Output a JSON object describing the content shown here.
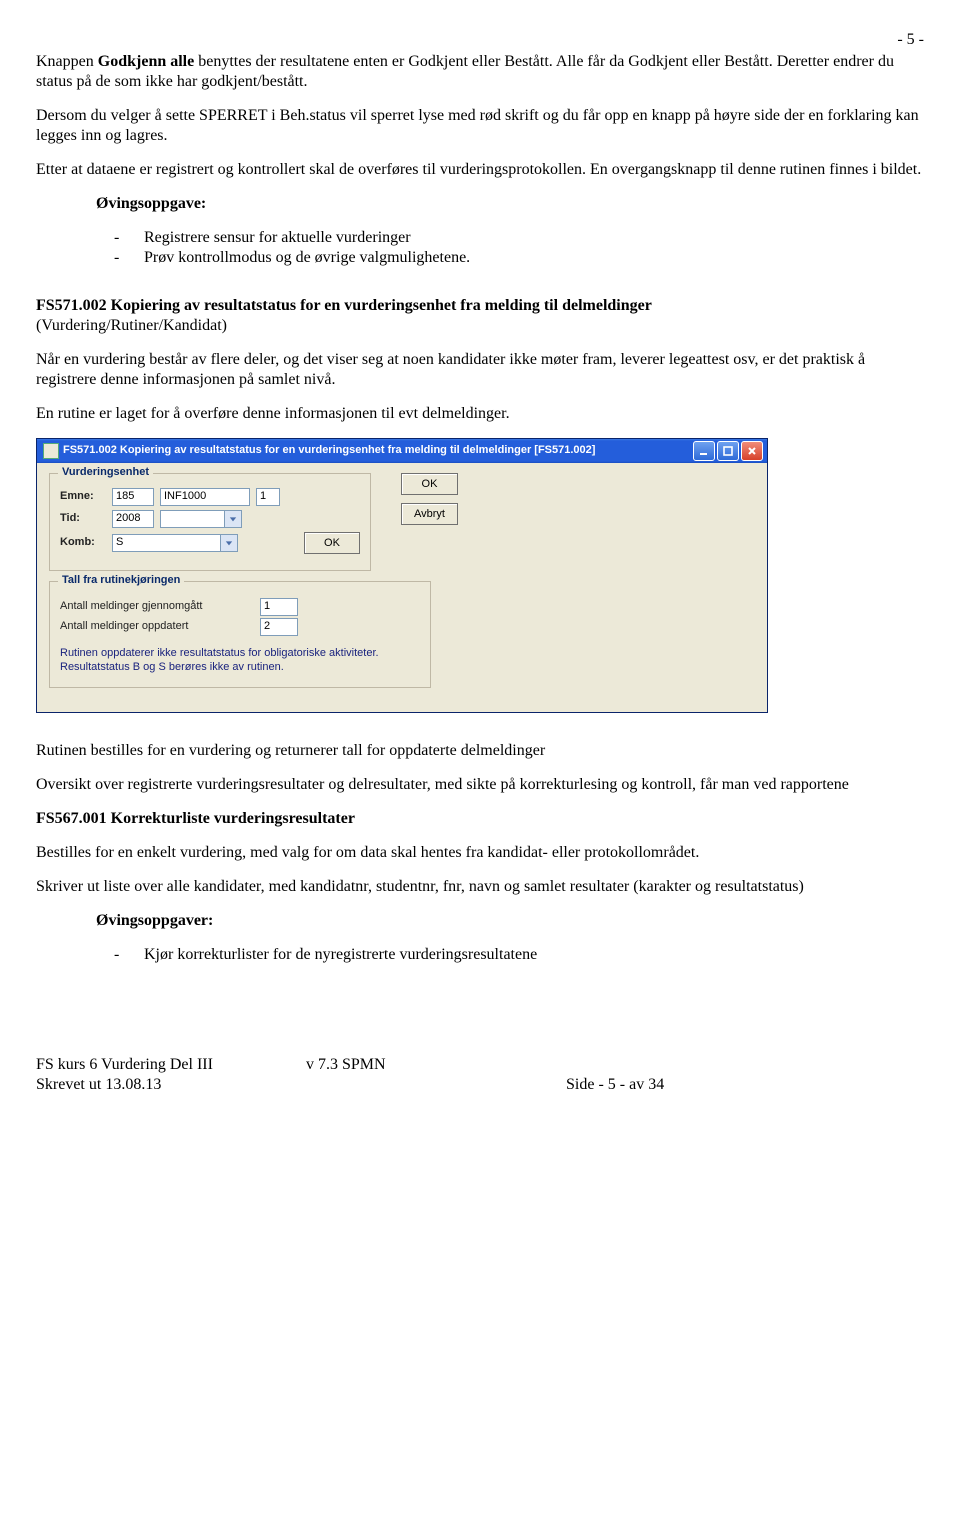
{
  "page_number_top": "- 5 -",
  "para1_a": "Knappen ",
  "para1_b_bold": "Godkjenn alle",
  "para1_c": " benyttes der resultatene enten er Godkjent eller Bestått. Alle får da Godkjent eller Bestått. Deretter endrer du status på de som ikke har godkjent/bestått.",
  "para2": "Dersom du velger å sette SPERRET i Beh.status vil sperret lyse med rød skrift og du får opp en knapp på høyre side der en forklaring kan legges inn og lagres.",
  "para3": "Etter at dataene er registrert og kontrollert skal de overføres til vurderingsprotokollen. En overgangsknapp til denne rutinen finnes i bildet.",
  "ov1_heading": "Øvingsoppgave:",
  "ov1_item1": "Registrere sensur for aktuelle vurderinger",
  "ov1_item2": "Prøv kontrollmodus og de øvrige valgmulighetene.",
  "h2_a": "FS571.002 Kopiering av resultatstatus for en vurderingsenhet fra melding til delmeldinger",
  "h2_sub": "(Vurdering/Rutiner/Kandidat)",
  "para4": "Når en vurdering består av flere deler, og det viser seg at noen kandidater ikke møter fram, leverer legeattest osv, er det praktisk å registrere denne informasjonen på samlet nivå.",
  "para5": "En rutine er laget for å overføre denne informasjonen til evt delmeldinger.",
  "win": {
    "title": "FS571.002 Kopiering av resultatstatus for en vurderingsenhet fra melding til delmeldinger [FS571.002]",
    "group1_legend": "Vurderingsenhet",
    "emne_lbl": "Emne:",
    "emne_v1": "185",
    "emne_v2": "INF1000",
    "emne_v3": "1",
    "tid_lbl": "Tid:",
    "tid_v": "2008",
    "komb_lbl": "Komb:",
    "komb_v": "S",
    "btn_ok": "OK",
    "btn_avbryt": "Avbryt",
    "group2_legend": "Tall fra rutinekjøringen",
    "tall1_lbl": "Antall meldinger gjennomgått",
    "tall1_v": "1",
    "tall2_lbl": "Antall meldinger oppdatert",
    "tall2_v": "2",
    "note1": "Rutinen oppdaterer ikke resultatstatus for obligatoriske aktiviteter. Resultatstatus B og S berøres ikke av rutinen."
  },
  "para6": "Rutinen bestilles for en vurdering og returnerer tall for oppdaterte delmeldinger",
  "para7": "Oversikt over registrerte vurderingsresultater og delresultater, med sikte på korrekturlesing og kontroll, får man ved rapportene",
  "h3": "FS567.001 Korrekturliste vurderingsresultater",
  "para8": "Bestilles for en enkelt vurdering, med valg for om data skal hentes fra kandidat- eller protokollområdet.",
  "para9": "Skriver ut liste over alle kandidater, med kandidatnr, studentnr, fnr, navn og samlet resultater (karakter og resultatstatus)",
  "ov2_heading": "Øvingsoppgaver:",
  "ov2_item1": "Kjør korrekturlister for de nyregistrerte vurderingsresultatene",
  "footer": {
    "l1a": "FS kurs 6 Vurdering Del III",
    "l1b": "v 7.3 SPMN",
    "l2a": "Skrevet ut 13.08.13",
    "l2c": "Side - 5 - av 34"
  }
}
